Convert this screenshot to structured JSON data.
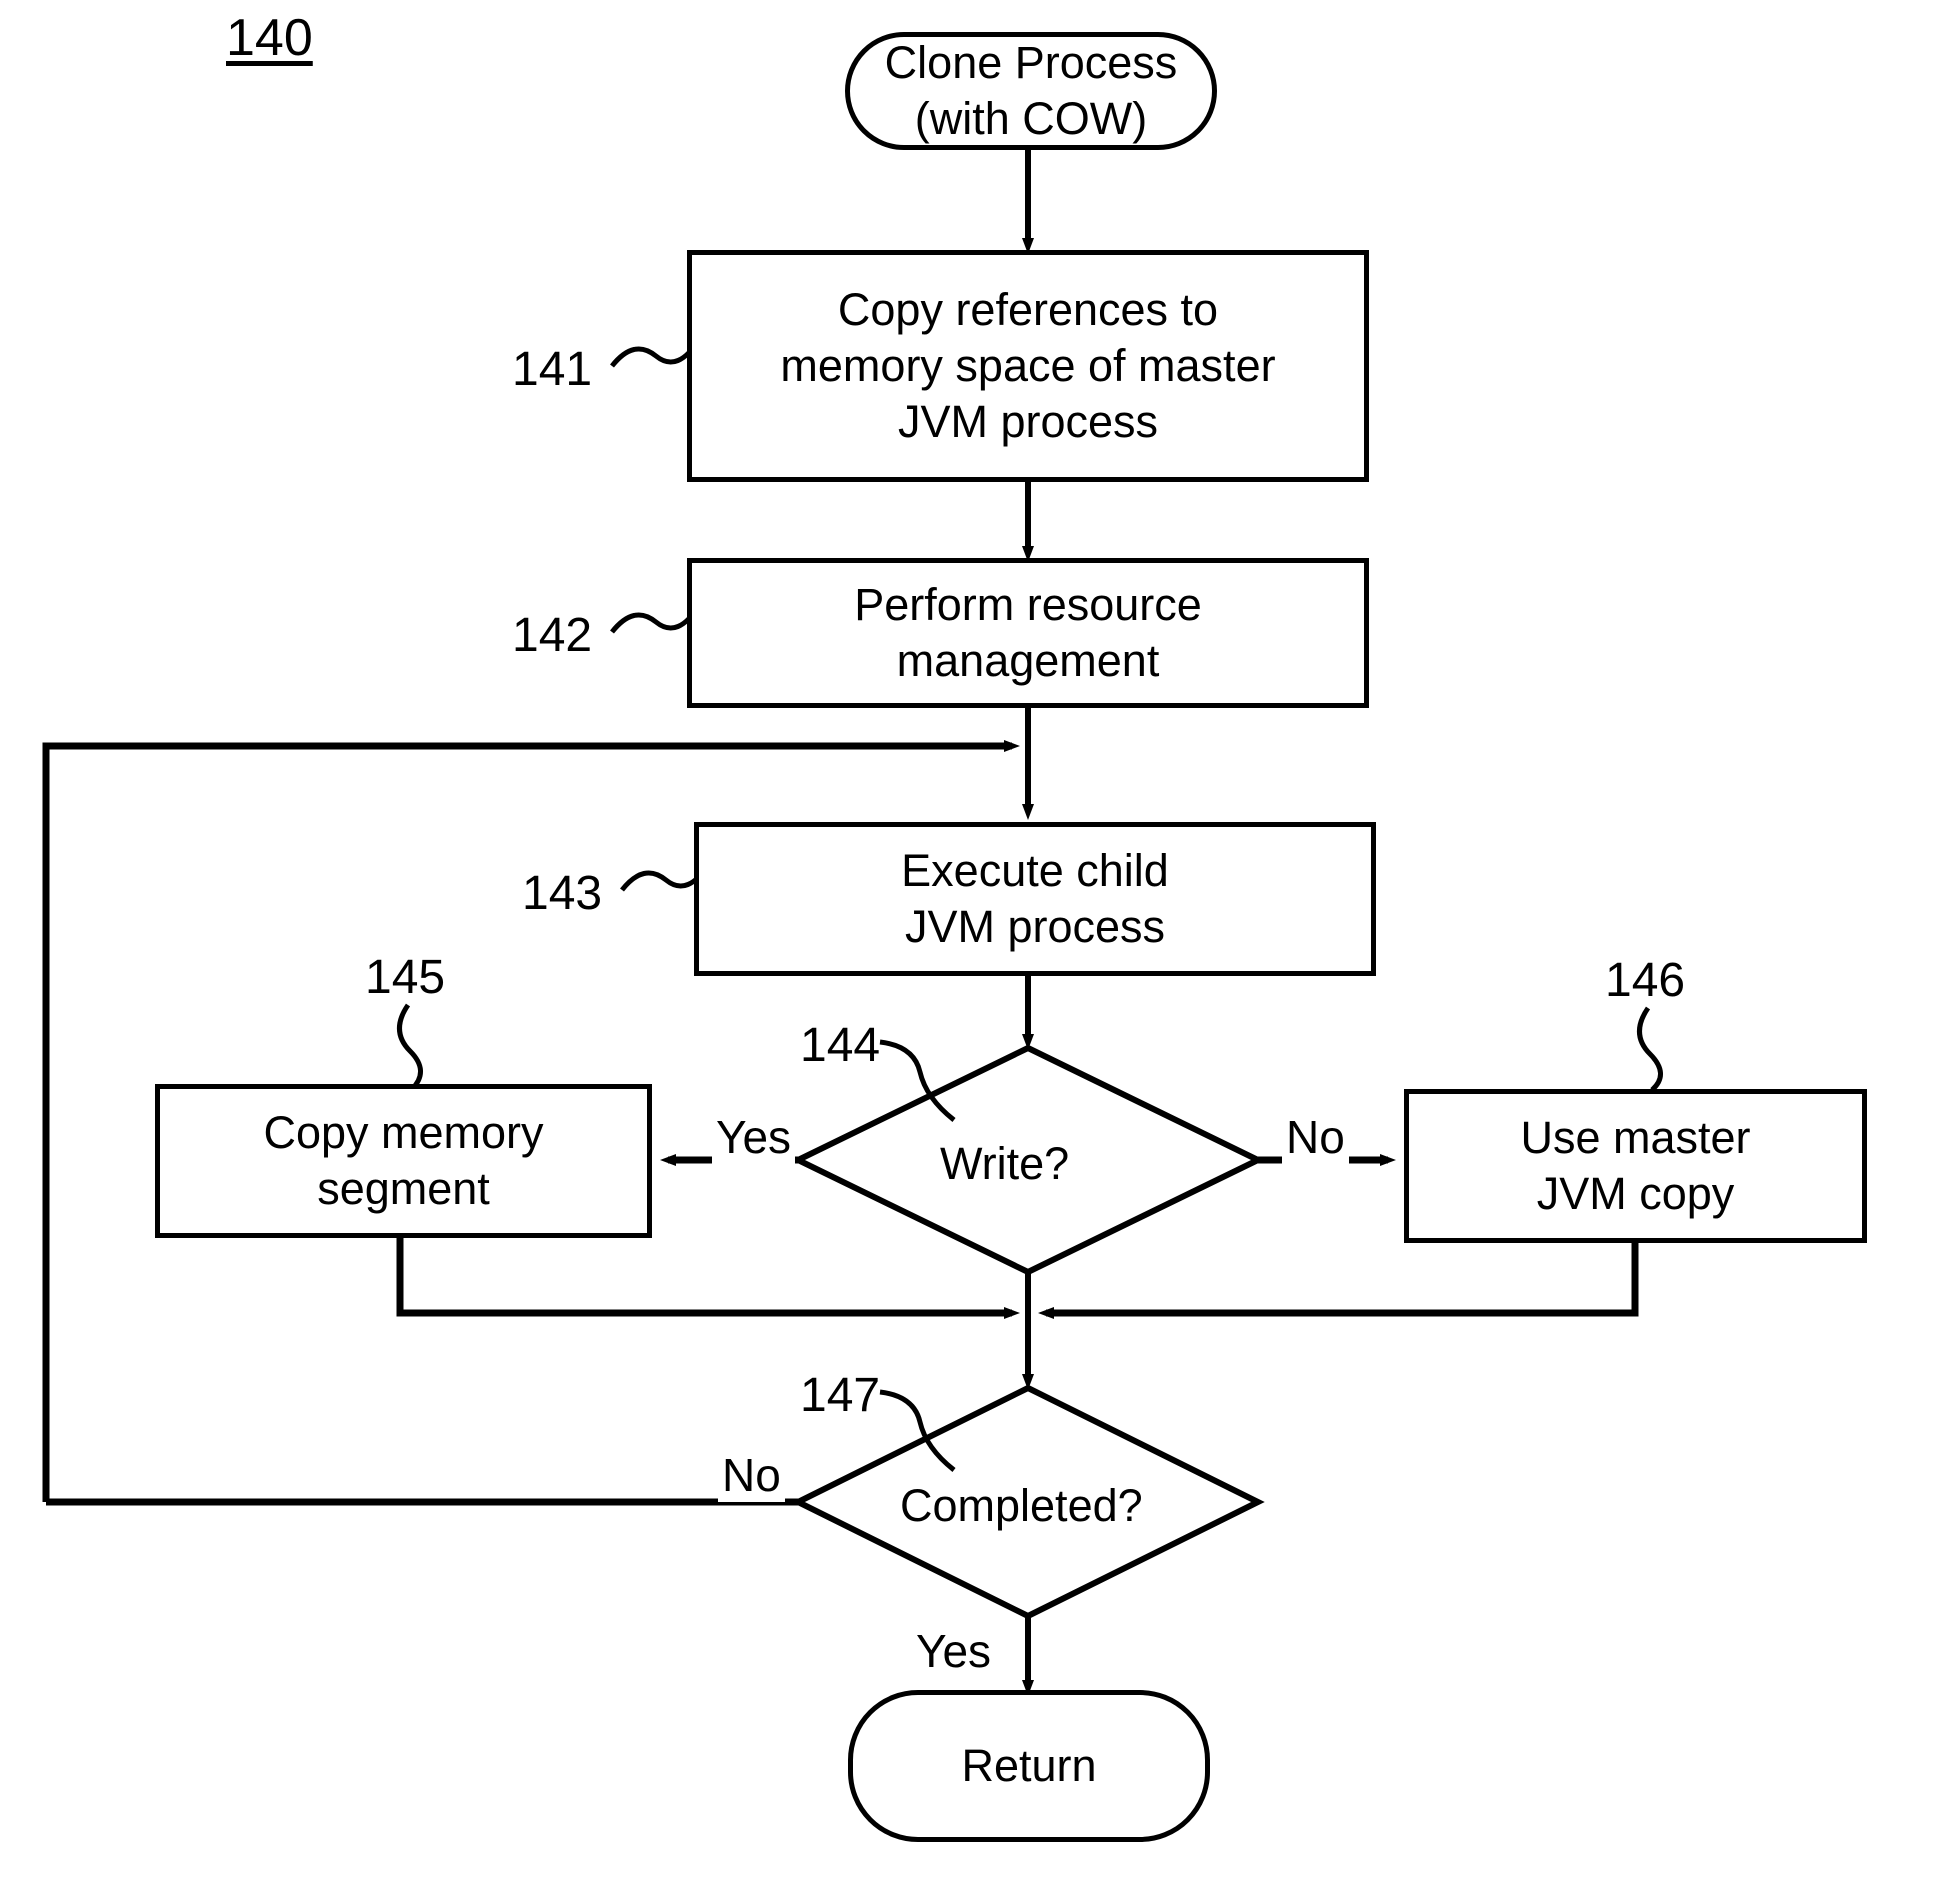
{
  "figure": {
    "number": "140"
  },
  "nodes": {
    "start": {
      "id": "start",
      "shape": "terminal",
      "line1": "Clone Process",
      "line2": "(with COW)"
    },
    "step141": {
      "ref": "141",
      "shape": "process",
      "line1": "Copy references to",
      "line2": "memory space of  master",
      "line3": "JVM process"
    },
    "step142": {
      "ref": "142",
      "shape": "process",
      "line1": "Perform resource",
      "line2": "management"
    },
    "step143": {
      "ref": "143",
      "shape": "process",
      "line1": "Execute child",
      "line2": "JVM process"
    },
    "decision144": {
      "ref": "144",
      "shape": "decision",
      "label": "Write?"
    },
    "step145": {
      "ref": "145",
      "shape": "process",
      "line1": "Copy memory",
      "line2": "segment"
    },
    "step146": {
      "ref": "146",
      "shape": "process",
      "line1": "Use master",
      "line2": "JVM copy"
    },
    "decision147": {
      "ref": "147",
      "shape": "decision",
      "label": "Completed?"
    },
    "end": {
      "id": "end",
      "shape": "terminal",
      "line1": "Return"
    }
  },
  "edge_labels": {
    "write_yes": "Yes",
    "write_no": "No",
    "completed_no": "No",
    "completed_yes": "Yes"
  },
  "style": {
    "stroke": "#000000",
    "fill": "#ffffff"
  }
}
